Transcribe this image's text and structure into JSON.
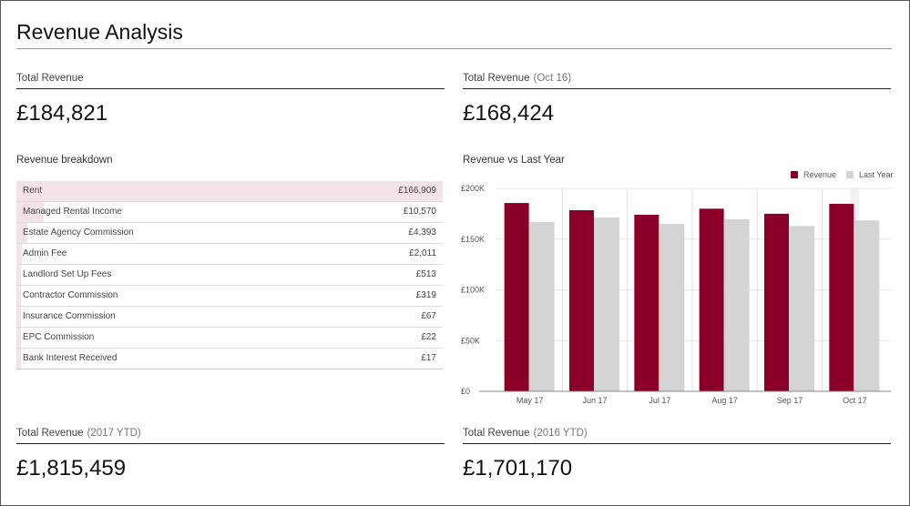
{
  "page": {
    "title": "Revenue Analysis"
  },
  "kpis": {
    "total_revenue": {
      "label": "Total Revenue",
      "sub": "",
      "value": "£184,821"
    },
    "total_revenue_oct16": {
      "label": "Total Revenue",
      "sub": "(Oct 16)",
      "value": "£168,424"
    },
    "total_revenue_2017_ytd": {
      "label": "Total Revenue",
      "sub": "(2017 YTD)",
      "value": "£1,815,459"
    },
    "total_revenue_2016_ytd": {
      "label": "Total Revenue",
      "sub": "(2016 YTD)",
      "value": "£1,701,170"
    }
  },
  "breakdown": {
    "title": "Revenue breakdown",
    "highlight_color": "#f3e3e7",
    "rows": [
      {
        "name": "Rent",
        "value": "£166,909",
        "amount": 166909
      },
      {
        "name": "Managed Rental Income",
        "value": "£10,570",
        "amount": 10570
      },
      {
        "name": "Estate Agency Commission",
        "value": "£4,393",
        "amount": 4393
      },
      {
        "name": "Admin Fee",
        "value": "£2,011",
        "amount": 2011
      },
      {
        "name": "Landlord Set Up Fees",
        "value": "£513",
        "amount": 513
      },
      {
        "name": "Contractor Commission",
        "value": "£319",
        "amount": 319
      },
      {
        "name": "Insurance Commission",
        "value": "£67",
        "amount": 67
      },
      {
        "name": "EPC Commission",
        "value": "£22",
        "amount": 22
      },
      {
        "name": "Bank Interest Received",
        "value": "£17",
        "amount": 17
      }
    ]
  },
  "chart_data": {
    "type": "bar",
    "title": "Revenue vs Last Year",
    "xlabel": "",
    "ylabel": "",
    "categories": [
      "May 17",
      "Jun 17",
      "Jul 17",
      "Aug 17",
      "Sep 17",
      "Oct 17"
    ],
    "series": [
      {
        "name": "Revenue",
        "color": "#8b0029",
        "values": [
          185600,
          178500,
          174000,
          180000,
          175000,
          184821
        ]
      },
      {
        "name": "Last Year",
        "color": "#d4d4d4",
        "values": [
          166800,
          171300,
          165000,
          169500,
          163000,
          168424
        ]
      }
    ],
    "ylim": [
      0,
      200000
    ],
    "yticks": [
      0,
      50000,
      100000,
      150000,
      200000
    ],
    "ytick_labels": [
      "£0",
      "£50K",
      "£100K",
      "£150K",
      "£200K"
    ],
    "grid": true,
    "legend_position": "top-right",
    "highlighted_category": "Oct 17"
  }
}
